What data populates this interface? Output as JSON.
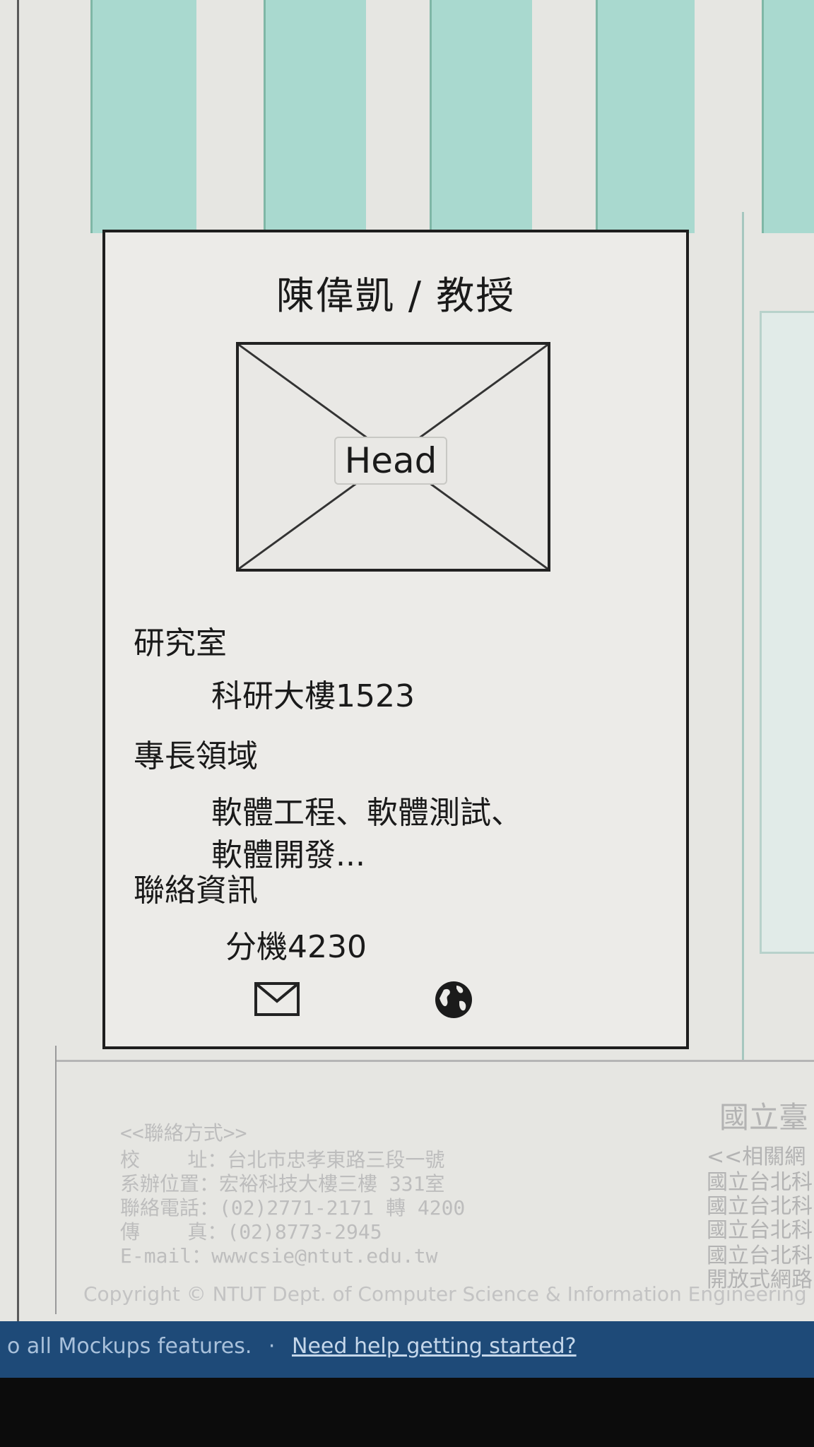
{
  "profile": {
    "title": "陳偉凱 / 教授",
    "image_placeholder": "Head",
    "lab_label": "研究室",
    "lab_value": "科研大樓1523",
    "expertise_label": "專長領域",
    "expertise_line1": "軟體工程、軟體測試、",
    "expertise_line2": "軟體開發...",
    "contact_label": "聯絡資訊",
    "contact_value": "分機4230",
    "icons": [
      "envelope-icon",
      "globe-icon"
    ]
  },
  "footer": {
    "contact_heading": "<<聯絡方式>>",
    "address": "校    址：台北市忠孝東路三段一號",
    "location": "系辦位置：宏裕科技大樓三樓 331室",
    "phone": "聯絡電話：(02)2771-2171 轉 4200",
    "fax": "傳    真：(02)8773-2945",
    "email": "E-mail：wwwcsie@ntut.edu.tw",
    "right_title": "國立臺",
    "right_heading": "<<相關網",
    "right_links": [
      "國立台北科",
      "國立台北科",
      "國立台北科",
      "國立台北科",
      "開放式網路"
    ],
    "copyright": "Copyright © NTUT Dept. of Computer Science & Information Engineering"
  },
  "status_bar": {
    "text": "o all Mockups features.",
    "separator": "·",
    "link": "Need help getting started?"
  },
  "colors": {
    "stripe": "#a9d9cf",
    "card_border": "#1e1e1e",
    "status_bar": "#1e4a78"
  }
}
